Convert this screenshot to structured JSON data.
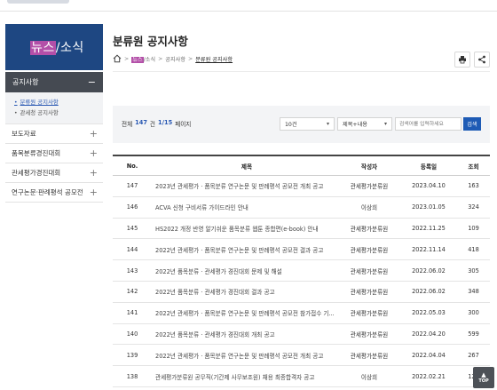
{
  "sidebar": {
    "hero": {
      "title_highlight": "뉴스",
      "title_rest": "/소식"
    },
    "active_section": "공지사항",
    "sub_items": [
      {
        "label": "분류원 공지사항",
        "active": true
      },
      {
        "label": "관세청 공지사항",
        "active": false
      }
    ],
    "items": [
      {
        "label": "보도자료"
      },
      {
        "label": "품목분류경진대회"
      },
      {
        "label": "관세평가경진대회"
      },
      {
        "label": "연구논문·판례평석 공모전"
      }
    ]
  },
  "header": {
    "title": "분류원 공지사항",
    "breadcrumb": {
      "hl": "뉴스",
      "rest": "/소식",
      "level2": "공지사항",
      "current": "분류원 공지사항"
    }
  },
  "search": {
    "total_label": "전체",
    "total": "147",
    "total_unit": "건",
    "page": "1/15",
    "page_label": "페이지",
    "page_size": "10건",
    "field": "제목+내용",
    "placeholder": "검색어를 입력하세요",
    "button_label": "검색"
  },
  "table": {
    "columns": [
      "No.",
      "제목",
      "작성자",
      "등록일",
      "조회"
    ],
    "rows": [
      {
        "no": "147",
        "title": "2023년 관세평가 · 품목분류 연구논문 및 판례평석 공모전 개최 공고",
        "author": "관세평가분류원",
        "date": "2023.04.10",
        "views": "163"
      },
      {
        "no": "146",
        "title": "ACVA 신청 구비서류 가이드라인 안내",
        "author": "이상희",
        "date": "2023.01.05",
        "views": "324"
      },
      {
        "no": "145",
        "title": "HS2022 개정 반영 알기쉬운 품목분류 웹툰 종합편(e-book) 안내",
        "author": "관세평가분류원",
        "date": "2022.11.25",
        "views": "109"
      },
      {
        "no": "144",
        "title": "2022년 관세평가 · 품목분류 연구논문 및 판례평석 공모전 결과 공고",
        "author": "관세평가분류원",
        "date": "2022.11.14",
        "views": "418"
      },
      {
        "no": "143",
        "title": "2022년 품목분류 · 관세평가 경진대회 문제 및 해설",
        "author": "관세평가분류원",
        "date": "2022.06.02",
        "views": "305"
      },
      {
        "no": "142",
        "title": "2022년 품목분류 · 관세평가 경진대회 결과 공고",
        "author": "관세평가분류원",
        "date": "2022.06.02",
        "views": "348"
      },
      {
        "no": "141",
        "title": "2022년 관세평가 · 품목분류 연구논문 및 판례평석 공모전 참가접수 기...",
        "author": "관세평가분류원",
        "date": "2022.05.03",
        "views": "300"
      },
      {
        "no": "140",
        "title": "2022년 품목분류 · 관세평가 경진대회 개최 공고",
        "author": "관세평가분류원",
        "date": "2022.04.20",
        "views": "599"
      },
      {
        "no": "139",
        "title": "2022년 관세평가 · 품목분류 연구논문 및 판례평석 공모전 개최 공고",
        "author": "관세평가분류원",
        "date": "2022.04.04",
        "views": "267"
      },
      {
        "no": "138",
        "title": "관세평가분류원 공무직(기간제 사무보조원) 채용 최종합격자 공고",
        "author": "이상희",
        "date": "2022.02.21",
        "views": "123"
      }
    ]
  },
  "top_button": {
    "label": "TOP"
  }
}
